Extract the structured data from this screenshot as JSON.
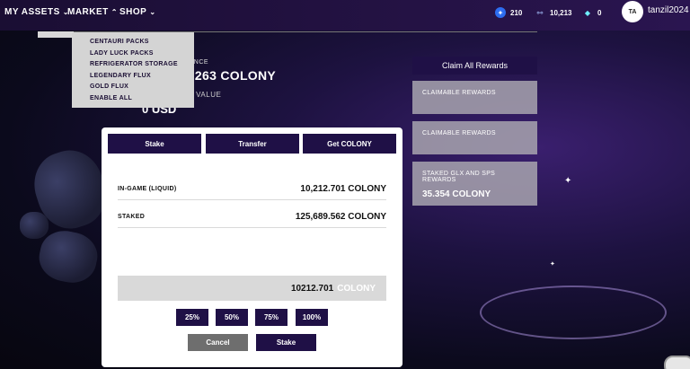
{
  "nav": {
    "my_assets": "MY ASSETS",
    "market": "MARKET",
    "shop": "SHOP"
  },
  "stats": {
    "stat1": "210",
    "stat2": "10,213",
    "stat3": "0"
  },
  "user": {
    "initials": "TA",
    "name": "tanzil2024"
  },
  "dropdown": {
    "items": [
      "CENTAURI PACKS",
      "LADY LUCK PACKS",
      "REFRIGERATOR STORAGE",
      "LEGENDARY FLUX",
      "GOLD FLUX",
      "ENABLE ALL"
    ]
  },
  "balance": {
    "label": "IN-GAME BALANCE",
    "value": "135,902.263 COLONY",
    "usd_label": "APPROX USD VALUE",
    "usd_value": "0 USD"
  },
  "rewards": {
    "claim_all": "Claim All Rewards",
    "card1_title": "CLAIMABLE REWARDS",
    "card2_title": "CLAIMABLE REWARDS",
    "card3_title": "STAKED GLX AND SPS REWARDS",
    "card3_value": "35.354 COLONY"
  },
  "modal": {
    "tabs": [
      "Stake",
      "Transfer",
      "Get COLONY"
    ],
    "rows": [
      {
        "label": "IN-GAME (LIQUID)",
        "value": "10,212.701 COLONY"
      },
      {
        "label": "STAKED",
        "value": "125,689.562 COLONY"
      }
    ],
    "amount": "10212.701",
    "amount_unit": "COLONY",
    "percents": [
      "25%",
      "50%",
      "75%",
      "100%"
    ],
    "cancel": "Cancel",
    "stake": "Stake"
  }
}
